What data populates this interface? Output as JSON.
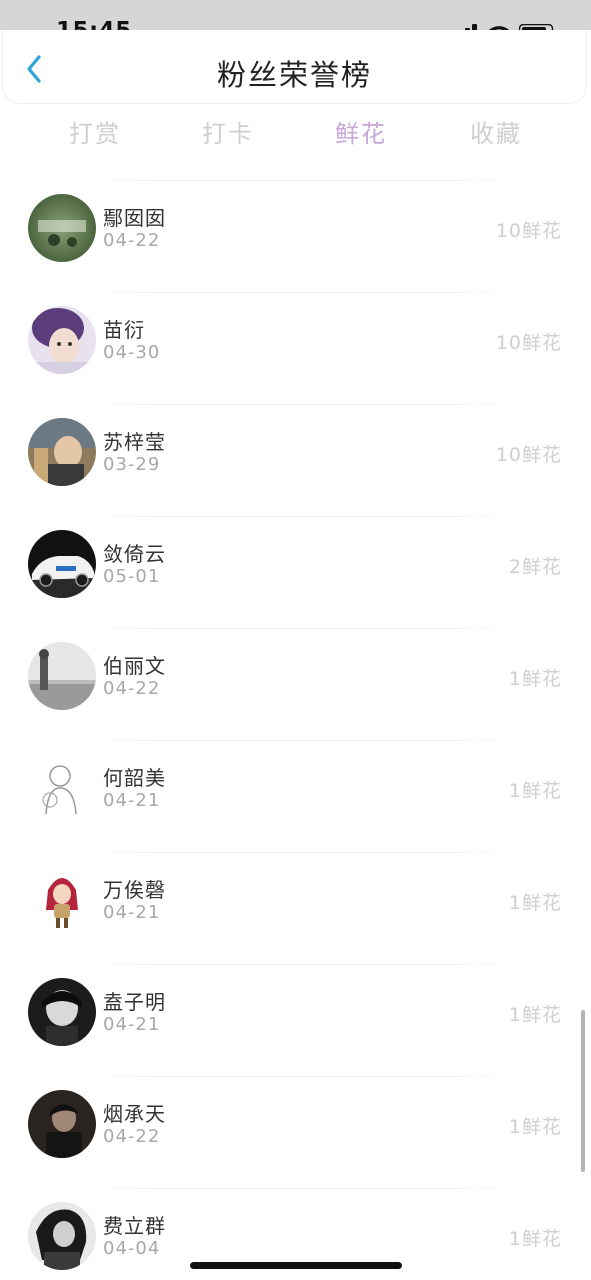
{
  "status_bar": {
    "time": "15:45",
    "icons": [
      "cellular-signal-icon",
      "wifi-icon",
      "battery-icon"
    ]
  },
  "header": {
    "title": "粉丝荣誉榜",
    "back_icon": "chevron-left-icon",
    "back_color": "#2ea3dc"
  },
  "tabs": [
    {
      "label": "打赏",
      "active": false
    },
    {
      "label": "打卡",
      "active": false
    },
    {
      "label": "鲜花",
      "active": true
    },
    {
      "label": "收藏",
      "active": false
    }
  ],
  "colors": {
    "active_tab": "#c8a6d9",
    "inactive_tab": "#cfcfcf",
    "count_text": "#cfcfcf",
    "date_text": "#a8a8a8"
  },
  "fans": [
    {
      "name": "鄢囡囡",
      "date": "04-22",
      "count": "10鲜花"
    },
    {
      "name": "苗衍",
      "date": "04-30",
      "count": "10鲜花"
    },
    {
      "name": "苏梓莹",
      "date": "03-29",
      "count": "10鲜花"
    },
    {
      "name": "敛倚云",
      "date": "05-01",
      "count": "2鲜花"
    },
    {
      "name": "伯丽文",
      "date": "04-22",
      "count": "1鲜花"
    },
    {
      "name": "何韶美",
      "date": "04-21",
      "count": "1鲜花"
    },
    {
      "name": "万俟磬",
      "date": "04-21",
      "count": "1鲜花"
    },
    {
      "name": "盍子明",
      "date": "04-21",
      "count": "1鲜花"
    },
    {
      "name": "烟承天",
      "date": "04-22",
      "count": "1鲜花"
    },
    {
      "name": "费立群",
      "date": "04-04",
      "count": "1鲜花"
    }
  ]
}
